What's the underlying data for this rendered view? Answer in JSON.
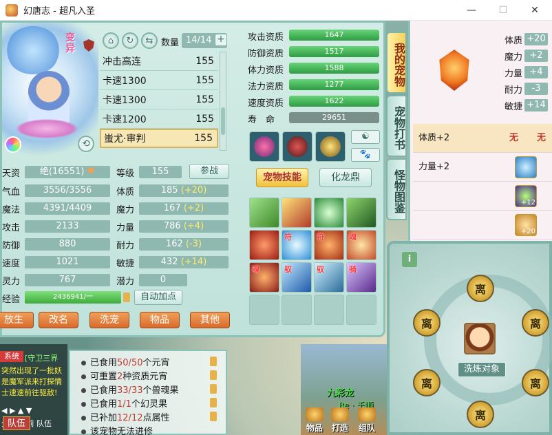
{
  "window": {
    "title": "幻唐志 - 超凡入圣",
    "controls": [
      "—",
      "☐",
      "✕"
    ]
  },
  "pet": {
    "morph_label": "变异",
    "qty_label": "数量",
    "qty_value": "14/14",
    "list": [
      {
        "name": "冲击高连",
        "level": "155"
      },
      {
        "name": "卡速1300",
        "level": "155"
      },
      {
        "name": "卡速1300",
        "level": "155"
      },
      {
        "name": "卡速1200",
        "level": "155"
      },
      {
        "name": "蚩尤·审判",
        "level": "155",
        "selected": true
      }
    ]
  },
  "attrs": {
    "tianzi_label": "天资",
    "tianzi_value": "绝(16551)",
    "level_label": "等级",
    "level_value": "155",
    "battle_btn": "参战",
    "qixue_label": "气血",
    "qixue_value": "3556/3556",
    "tizhi_label": "体质",
    "tizhi_value": "185",
    "tizhi_bonus": "(+20)",
    "mofa_label": "魔法",
    "mofa_value": "4391/4409",
    "moli_label": "魔力",
    "moli_value": "167",
    "moli_bonus": "(+2)",
    "gongji_label": "攻击",
    "gongji_value": "2133",
    "liliang_label": "力量",
    "liliang_value": "786",
    "liliang_bonus": "(+4)",
    "fangyu_label": "防御",
    "fangyu_value": "880",
    "naili_label": "耐力",
    "naili_value": "162",
    "naili_bonus": "(-3)",
    "sudu_label": "速度",
    "sudu_value": "1021",
    "minjie_label": "敏捷",
    "minjie_value": "432",
    "minjie_bonus": "(+14)",
    "lingli_label": "灵力",
    "lingli_value": "767",
    "qianli_label": "潜力",
    "qianli_value": "0",
    "exp_label": "经验",
    "exp_value": "2436941/一",
    "exp_fraction": 1.0,
    "auto_btn": "自动加点"
  },
  "bottom_buttons": [
    "放生",
    "改名",
    "洗宠",
    "物品",
    "其他"
  ],
  "aptitudes": [
    {
      "label": "攻击资质",
      "value": "1647"
    },
    {
      "label": "防御资质",
      "value": "1517"
    },
    {
      "label": "体力资质",
      "value": "1588"
    },
    {
      "label": "法力资质",
      "value": "1277"
    },
    {
      "label": "速度资质",
      "value": "1622"
    },
    {
      "label": "寿　命",
      "value": "29651"
    }
  ],
  "tabs": {
    "skill": "宠物技能",
    "hualong": "化龙鼎"
  },
  "skill_tags": [
    "",
    "",
    "",
    "",
    "",
    "符",
    "符",
    "魂",
    "魂",
    "驭",
    "驭",
    "骑"
  ],
  "side_tabs": [
    "我的宠物",
    "宠物打书",
    "怪物图鉴"
  ],
  "right": {
    "stats": [
      {
        "label": "体质",
        "value": "+20"
      },
      {
        "label": "魔力",
        "value": "+2"
      },
      {
        "label": "力量",
        "value": "+4"
      },
      {
        "label": "耐力",
        "value": "-3"
      },
      {
        "label": "敏捷",
        "value": "+14"
      }
    ],
    "rows": [
      {
        "label": "体质+2",
        "none1": "无",
        "none2": "无"
      },
      {
        "label": "力量+2"
      },
      {
        "label": "",
        "badge": "+12"
      },
      {
        "label": "",
        "badge": "+20"
      }
    ]
  },
  "refine": {
    "info": "i",
    "slot_label": "离",
    "target_btn": "洗炼对象"
  },
  "chat": {
    "sys": "系统",
    "lines": [
      "[守卫三界",
      "突然出现了一批妖",
      "是魔军派来打探情",
      "士速速前往驱敌!"
    ],
    "controls": "◀ ▶ ▲ ▼",
    "tabs": "全部 当前 队伍",
    "team_btn": "队伍"
  },
  "info": [
    {
      "pre": "已食用",
      "red": "50/50",
      "post": "个元宵"
    },
    {
      "pre": "可重置",
      "red": "2",
      "post": "种资质元宵"
    },
    {
      "pre": "已食用",
      "red": "33/33",
      "post": "个兽魂果"
    },
    {
      "pre": "已食用",
      "red": "1/1",
      "post": "个幻灵果"
    },
    {
      "pre": "已补加",
      "red": "12/12",
      "post": "点属性"
    },
    {
      "pre": "该宠物无法进修",
      "red": "",
      "post": ""
    }
  ],
  "scene": {
    "text1": "九彩龙",
    "text2": "Re · 千顺",
    "buttons": [
      "物品",
      "打造",
      "组队"
    ]
  },
  "colors": {
    "panel": "#d4ece6",
    "bar": "#8fb9b0",
    "bonus": "#ffec6b",
    "orange_btn": "#d86a2c",
    "apt_bar": "#2f9c45"
  }
}
